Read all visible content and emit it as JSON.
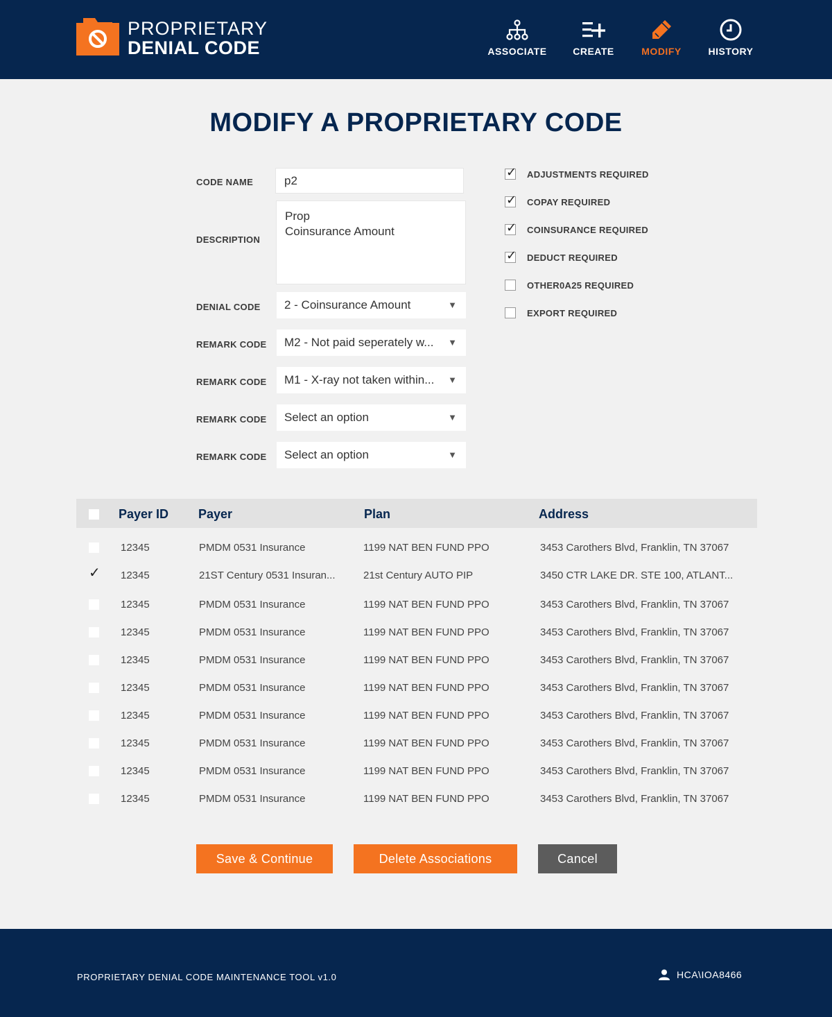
{
  "header": {
    "logo_line1": "PROPRIETARY",
    "logo_line2": "DENIAL CODE",
    "nav": {
      "associate": "ASSOCIATE",
      "create": "CREATE",
      "modify": "MODIFY",
      "history": "HISTORY"
    },
    "active_nav": "modify",
    "active_color": "#f26f21"
  },
  "page_title": "MODIFY A PROPRIETARY CODE",
  "form": {
    "code_name_label": "CODE NAME",
    "code_name_value": "p2",
    "description_label": "DESCRIPTION",
    "description_line1": "Prop",
    "description_line2": "Coinsurance Amount",
    "denial_code_label": "DENIAL CODE",
    "denial_code_value": "2 - Coinsurance Amount",
    "remark_label": "REMARK CODE",
    "remark_codes": [
      "M2 - Not paid seperately w...",
      "M1 - X-ray not taken within...",
      "Select an option",
      "Select an option"
    ]
  },
  "requirements": [
    {
      "label": "ADJUSTMENTS REQUIRED",
      "checked": true
    },
    {
      "label": "COPAY REQUIRED",
      "checked": true
    },
    {
      "label": "COINSURANCE REQUIRED",
      "checked": true
    },
    {
      "label": "DEDUCT REQUIRED",
      "checked": true
    },
    {
      "label": "OTHER0A25 REQUIRED",
      "checked": false
    },
    {
      "label": "EXPORT REQUIRED",
      "checked": false
    }
  ],
  "table": {
    "headers": {
      "payer_id": "Payer ID",
      "payer": "Payer",
      "plan": "Plan",
      "address": "Address"
    },
    "rows": [
      {
        "checked": false,
        "payer_id": "12345",
        "payer": "PMDM 0531 Insurance",
        "plan": "1199 NAT BEN FUND PPO",
        "address": "3453 Carothers Blvd, Franklin, TN 37067"
      },
      {
        "checked": true,
        "payer_id": "12345",
        "payer": "21ST Century 0531 Insuran...",
        "plan": "21st Century AUTO PIP",
        "address": "3450 CTR LAKE DR. STE 100, ATLANT..."
      },
      {
        "checked": false,
        "payer_id": "12345",
        "payer": "PMDM 0531 Insurance",
        "plan": "1199 NAT BEN FUND PPO",
        "address": "3453 Carothers Blvd, Franklin, TN 37067"
      },
      {
        "checked": false,
        "payer_id": "12345",
        "payer": "PMDM 0531 Insurance",
        "plan": "1199 NAT BEN FUND PPO",
        "address": "3453 Carothers Blvd, Franklin, TN 37067"
      },
      {
        "checked": false,
        "payer_id": "12345",
        "payer": "PMDM 0531 Insurance",
        "plan": "1199 NAT BEN FUND PPO",
        "address": "3453 Carothers Blvd, Franklin, TN 37067"
      },
      {
        "checked": false,
        "payer_id": "12345",
        "payer": "PMDM 0531 Insurance",
        "plan": "1199 NAT BEN FUND PPO",
        "address": "3453 Carothers Blvd, Franklin, TN 37067"
      },
      {
        "checked": false,
        "payer_id": "12345",
        "payer": "PMDM 0531 Insurance",
        "plan": "1199 NAT BEN FUND PPO",
        "address": "3453 Carothers Blvd, Franklin, TN 37067"
      },
      {
        "checked": false,
        "payer_id": "12345",
        "payer": "PMDM 0531 Insurance",
        "plan": "1199 NAT BEN FUND PPO",
        "address": "3453 Carothers Blvd, Franklin, TN 37067"
      },
      {
        "checked": false,
        "payer_id": "12345",
        "payer": "PMDM 0531 Insurance",
        "plan": "1199 NAT BEN FUND PPO",
        "address": "3453 Carothers Blvd, Franklin, TN 37067"
      },
      {
        "checked": false,
        "payer_id": "12345",
        "payer": "PMDM 0531 Insurance",
        "plan": "1199 NAT BEN FUND PPO",
        "address": "3453 Carothers Blvd, Franklin, TN 37067"
      }
    ]
  },
  "buttons": {
    "save": "Save & Continue",
    "delete": "Delete Associations",
    "cancel": "Cancel"
  },
  "footer": {
    "tool_name": "PROPRIETARY DENIAL CODE MAINTENANCE TOOL v1.0",
    "user": "HCA\\IOA8466"
  },
  "colors": {
    "navy": "#06264f",
    "orange": "#f47320",
    "gray_button": "#5c5c5c"
  }
}
